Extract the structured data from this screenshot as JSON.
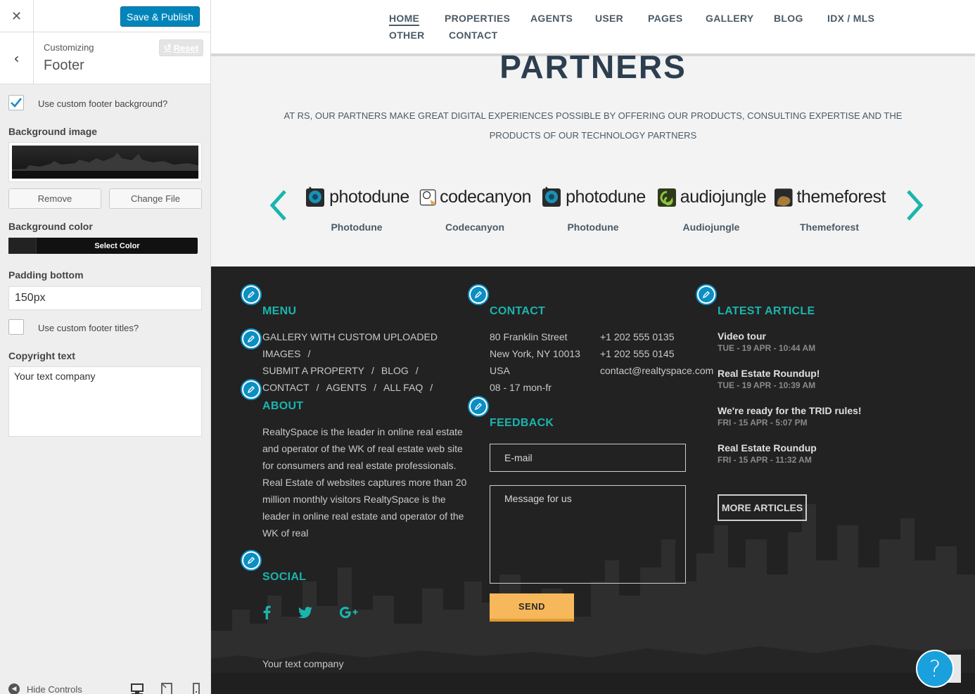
{
  "customizer": {
    "close_icon": "close-icon",
    "publish_label": "Save & Publish",
    "customizing_label": "Customizing",
    "section_title": "Footer",
    "reset_label": "Reset",
    "use_custom_bg_label": "Use custom footer background?",
    "use_custom_bg_checked": true,
    "bg_image_label": "Background image",
    "remove_label": "Remove",
    "change_file_label": "Change File",
    "bg_color_label": "Background color",
    "select_color_label": "Select Color",
    "bg_color_value": "#111111",
    "padding_label": "Padding bottom",
    "padding_value": "150px",
    "use_custom_titles_label": "Use custom footer titles?",
    "use_custom_titles_checked": false,
    "copyright_label": "Copyright text",
    "copyright_value": "Your text company",
    "hide_controls_label": "Hide Controls",
    "accent_color": "#0085ba"
  },
  "nav": {
    "items": [
      "HOME",
      "PROPERTIES",
      "AGENTS",
      "USER",
      "PAGES",
      "GALLERY",
      "BLOG",
      "IDX / MLS",
      "OTHER",
      "CONTACT"
    ],
    "active": "HOME"
  },
  "partners": {
    "title": "PARTNERS",
    "description": "AT RS, OUR PARTNERS MAKE GREAT DIGITAL EXPERIENCES POSSIBLE BY OFFERING OUR PRODUCTS, CONSULTING EXPERTISE AND THE PRODUCTS OF OUR TECHNOLOGY PARTNERS",
    "items": [
      {
        "logo": "photodune",
        "name": "Photodune"
      },
      {
        "logo": "codecanyon",
        "name": "Codecanyon"
      },
      {
        "logo": "photodune",
        "name": "Photodune"
      },
      {
        "logo": "audiojungle",
        "name": "Audiojungle"
      },
      {
        "logo": "themeforest",
        "name": "Themeforest"
      }
    ]
  },
  "footer": {
    "menu_title": "MENU",
    "menu_links": [
      "GALLERY WITH CUSTOM UPLOADED IMAGES",
      "SUBMIT A PROPERTY",
      "BLOG",
      "CONTACT",
      "AGENTS",
      "ALL FAQ"
    ],
    "about_title": "ABOUT",
    "about_text": "RealtySpace is the leader in online real estate and operator of the WK of real estate web site for consumers and real estate professionals. Real Estate of websites captures more than 20 million monthly visitors RealtySpace is the leader in online real estate and operator of the WK of real",
    "social_title": "SOCIAL",
    "social_icons": [
      "facebook-icon",
      "twitter-icon",
      "google-plus-icon"
    ],
    "contact_title": "CONTACT",
    "address_line1": "80 Franklin Street",
    "address_line2": "New York, NY 10013",
    "address_line3": "USA",
    "hours": "08 - 17 mon-fr",
    "phone1": "+1 202 555 0135",
    "phone2": "+1 202 555 0145",
    "email": "contact@realtyspace.com",
    "feedback_title": "FEEDBACK",
    "email_placeholder": "E-mail",
    "message_placeholder": "Message for us",
    "send_label": "SEND",
    "latest_title": "LATEST ARTICLE",
    "articles": [
      {
        "title": "Video tour",
        "date": "TUE - 19 APR - 10:44 AM"
      },
      {
        "title": "Real Estate Roundup!",
        "date": "TUE - 19 APR - 10:39 AM"
      },
      {
        "title": "We're ready for the TRID rules!",
        "date": "FRI - 15 APR - 5:07 PM"
      },
      {
        "title": "Real Estate Roundup",
        "date": "FRI - 15 APR - 11:32 AM"
      }
    ],
    "more_articles_label": "MORE ARTICLES",
    "copyright": "Your text company",
    "title_color": "#1ab5ae",
    "send_color": "#f6b85a"
  },
  "help_label": "?"
}
